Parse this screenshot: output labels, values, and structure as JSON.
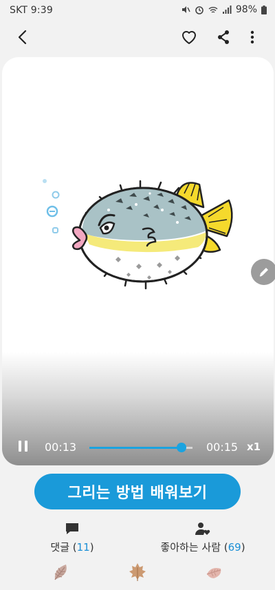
{
  "status": {
    "carrier_time": "SKT 9:39",
    "battery": "98%"
  },
  "player": {
    "current_time": "00:13",
    "end_time": "00:15",
    "speed": "x1",
    "progress": 0.89
  },
  "cta": {
    "label": "그리는 방법 배워보기"
  },
  "stats": {
    "comments_label": "댓글",
    "comments_count": "11",
    "likers_label": "좋아하는 사람",
    "likers_count": "69"
  },
  "colors": {
    "accent": "#1a9ad9",
    "fish_body": "#a9c2c6",
    "fish_fin": "#f5d92c",
    "fish_lips": "#f2a7c1"
  },
  "icons": [
    "back-icon",
    "heart-icon",
    "share-icon",
    "more-icon",
    "pause-icon",
    "pencil-icon",
    "comment-icon",
    "person-heart-icon",
    "leaf-icon",
    "maple-leaf-icon",
    "oak-leaf-icon"
  ]
}
